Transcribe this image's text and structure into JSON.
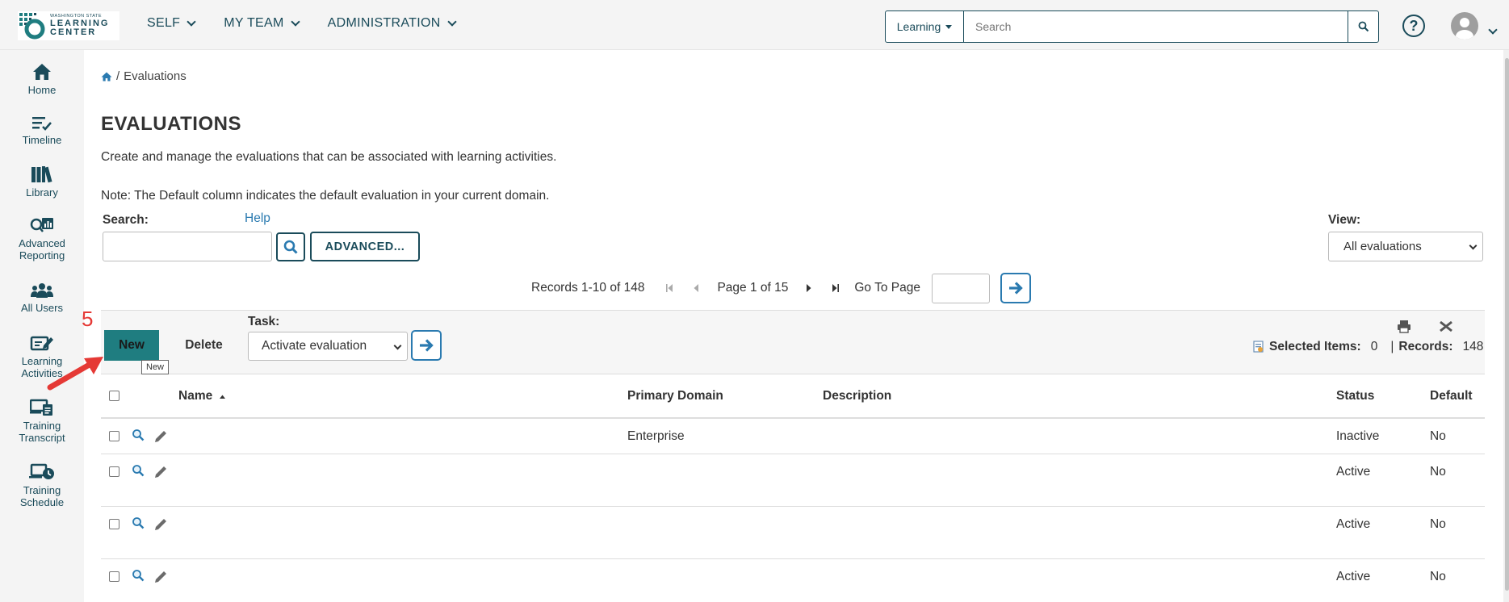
{
  "header": {
    "logo_small": "WASHINGTON STATE",
    "logo_line1": "LEARNING",
    "logo_line2": "CENTER",
    "nav": [
      "SELF",
      "MY TEAM",
      "ADMINISTRATION"
    ],
    "search_scope": "Learning",
    "search_placeholder": "Search",
    "help_glyph": "?"
  },
  "sidebar": {
    "items": [
      {
        "label": "Home",
        "icon": "home-icon"
      },
      {
        "label": "Timeline",
        "icon": "timeline-icon"
      },
      {
        "label": "Library",
        "icon": "library-icon"
      },
      {
        "label": "Advanced Reporting",
        "icon": "reporting-icon"
      },
      {
        "label": "All Users",
        "icon": "users-icon"
      },
      {
        "label": "Learning Activities",
        "icon": "activities-icon"
      },
      {
        "label": "Training Transcript",
        "icon": "transcript-icon"
      },
      {
        "label": "Training Schedule",
        "icon": "schedule-icon"
      }
    ]
  },
  "main": {
    "breadcrumb_current": "Evaluations",
    "breadcrumb_sep": "/",
    "title": "EVALUATIONS",
    "description": "Create and manage the evaluations that can be associated with learning activities.",
    "note": "Note: The Default column indicates the default evaluation in your current domain.",
    "search_label": "Search:",
    "help_label": "Help",
    "advanced_label": "ADVANCED...",
    "view_label": "View:",
    "view_value": "All evaluations",
    "records_text": "Records 1-10 of 148",
    "page_text": "Page 1 of 15",
    "goto_label": "Go To Page"
  },
  "toolbar": {
    "new_label": "New",
    "delete_label": "Delete",
    "tooltip": "New",
    "annotation_number": "5",
    "task_label": "Task:",
    "task_value": "Activate evaluation",
    "selected_label": "Selected Items:",
    "selected_count": "0",
    "records_label": "Records:",
    "records_count": "148",
    "separator": "|"
  },
  "table": {
    "headers": {
      "name": "Name",
      "primary_domain": "Primary Domain",
      "description": "Description",
      "status": "Status",
      "default": "Default"
    },
    "rows": [
      {
        "name": "",
        "primary_domain": "Enterprise",
        "description": "",
        "status": "Inactive",
        "default": "No"
      },
      {
        "name": "",
        "primary_domain": "",
        "description": "",
        "status": "Active",
        "default": "No"
      },
      {
        "name": "",
        "primary_domain": "",
        "description": "",
        "status": "Active",
        "default": "No"
      },
      {
        "name": "",
        "primary_domain": "",
        "description": "",
        "status": "Active",
        "default": "No"
      }
    ]
  },
  "colors": {
    "brand": "#1a4b5a",
    "accent": "#1f7d80",
    "link": "#2a7ab0",
    "annotation": "#e53935"
  }
}
